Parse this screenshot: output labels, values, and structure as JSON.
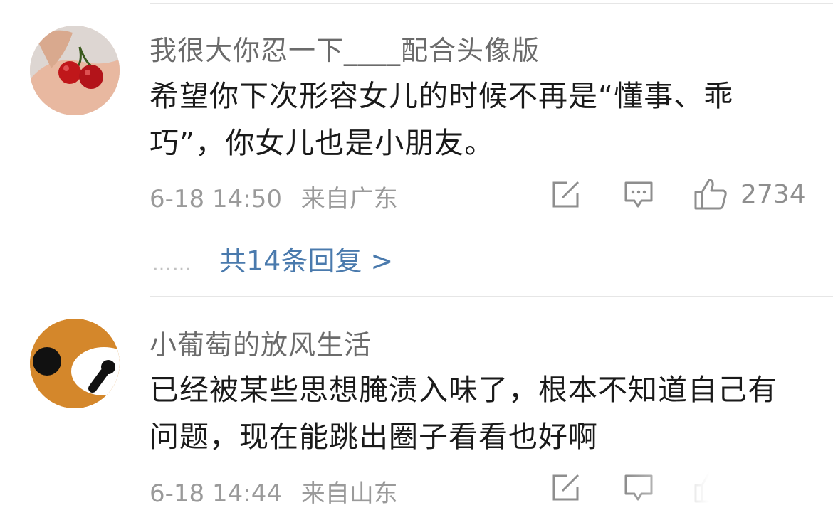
{
  "comments": [
    {
      "username": "我很大你忍一下____配合头像版",
      "text": "希望你下次形容女儿的时候不再是“懂事、乖巧”，你女儿也是小朋友。",
      "date": "6-18 14:50",
      "location": "来自广东",
      "likes": "2734",
      "replies_label": "共14条回复 >",
      "replies_dots": "……",
      "avatar_icon": "cherries-in-hand-avatar"
    },
    {
      "username": "小葡萄的放风生活",
      "text": "已经被某些思想腌渍入味了，根本不知道自己有问题，现在能跳出圈子看看也好啊",
      "date": "6-18 14:44",
      "location": "来自山东",
      "avatar_icon": "cartoon-bear-avatar"
    }
  ],
  "icons": {
    "share": "share-icon",
    "comment": "comment-icon",
    "like": "thumbs-up-icon"
  },
  "colors": {
    "link": "#4a7aad",
    "meta": "#9a9a9a",
    "username": "#6b6b6b",
    "text": "#1a1a1a"
  }
}
